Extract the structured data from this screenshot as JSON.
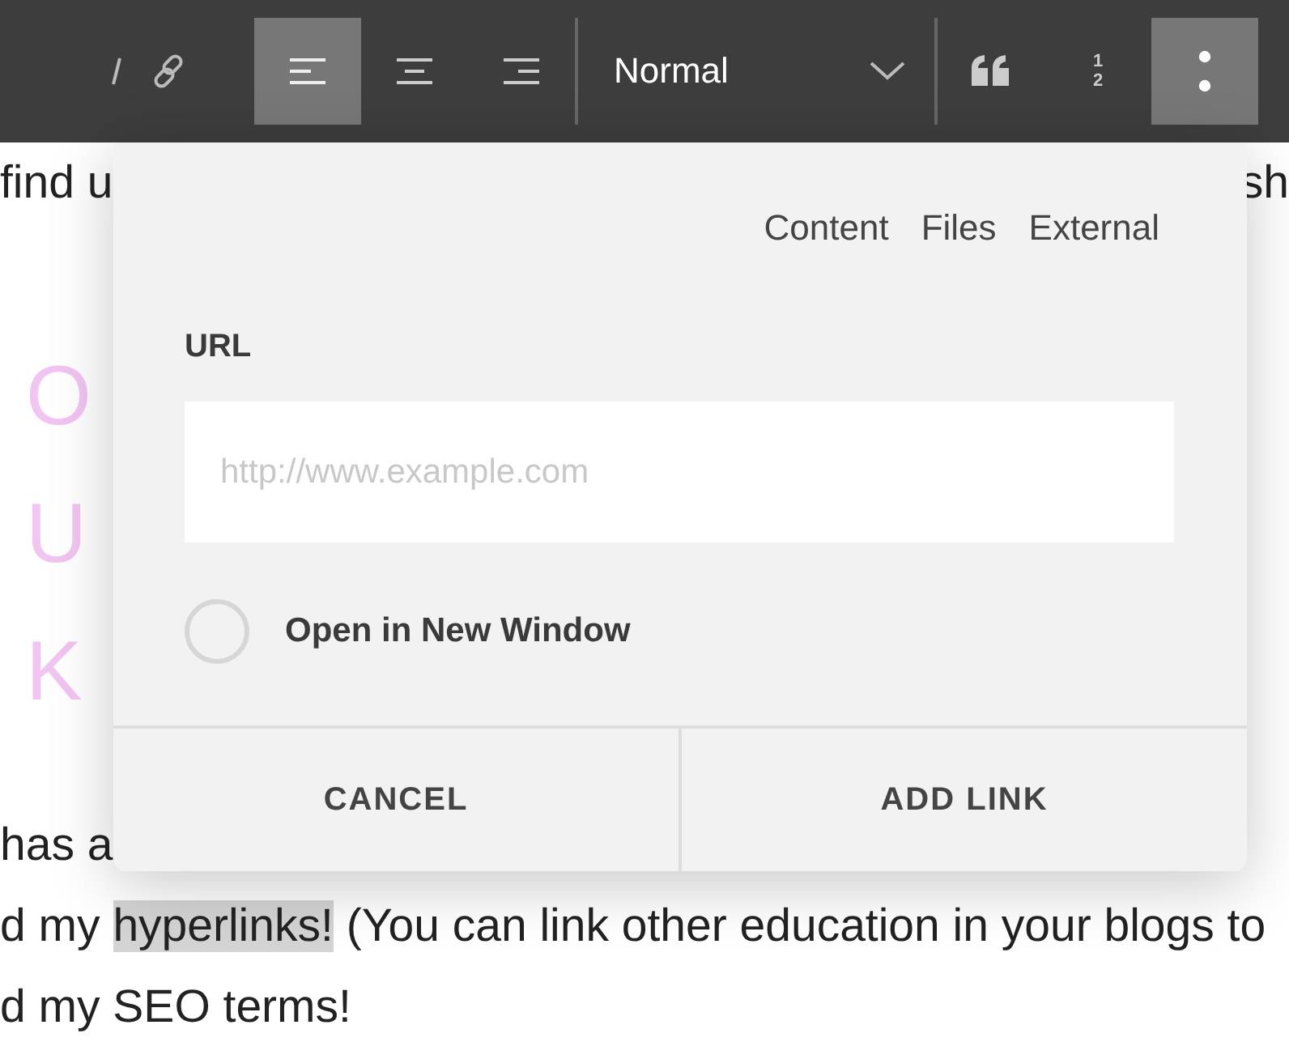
{
  "toolbar": {
    "groups": [
      {
        "kind": "buttons",
        "items": [
          {
            "kind": "italic",
            "selected": false
          },
          {
            "kind": "link",
            "selected": false
          }
        ]
      },
      {
        "kind": "buttons",
        "items": [
          {
            "kind": "align-left",
            "selected": true
          },
          {
            "kind": "align-center",
            "selected": false
          },
          {
            "kind": "align-right",
            "selected": false
          }
        ]
      },
      {
        "kind": "dropdown",
        "value": "Normal"
      },
      {
        "kind": "buttons",
        "items": [
          {
            "kind": "quote",
            "selected": false
          },
          {
            "kind": "ordered-list",
            "digits": [
              "1",
              "2"
            ],
            "selected": false
          },
          {
            "kind": "more",
            "selected": true
          }
        ]
      }
    ]
  },
  "background": {
    "top_line": {
      "left": "find u",
      "right": "sh"
    },
    "heading_rows": [
      {
        "left": "O"
      },
      {
        "left": "U"
      },
      {
        "left": "K"
      }
    ],
    "lines": [
      {
        "segments": [
          {
            "text": "has a",
            "highlighted": false
          }
        ]
      },
      {
        "segments": [
          {
            "text": "d my ",
            "highlighted": false
          },
          {
            "text": "hyperlinks!",
            "highlighted": true
          },
          {
            "text": " (You can link other education in your blogs to",
            "highlighted": false
          }
        ]
      },
      {
        "segments": [
          {
            "text": "d my SEO terms!",
            "highlighted": false
          }
        ]
      }
    ]
  },
  "link_dialog": {
    "tabs": [
      {
        "label": "Content",
        "selected": false
      },
      {
        "label": "Files",
        "selected": false
      },
      {
        "label": "External",
        "selected": false
      }
    ],
    "url_label": "URL",
    "url_field": {
      "placeholder": "http://www.example.com"
    },
    "new_window": {
      "label": "Open in New Window",
      "checked": false
    },
    "buttons": [
      "CANCEL",
      "ADD LINK"
    ]
  }
}
